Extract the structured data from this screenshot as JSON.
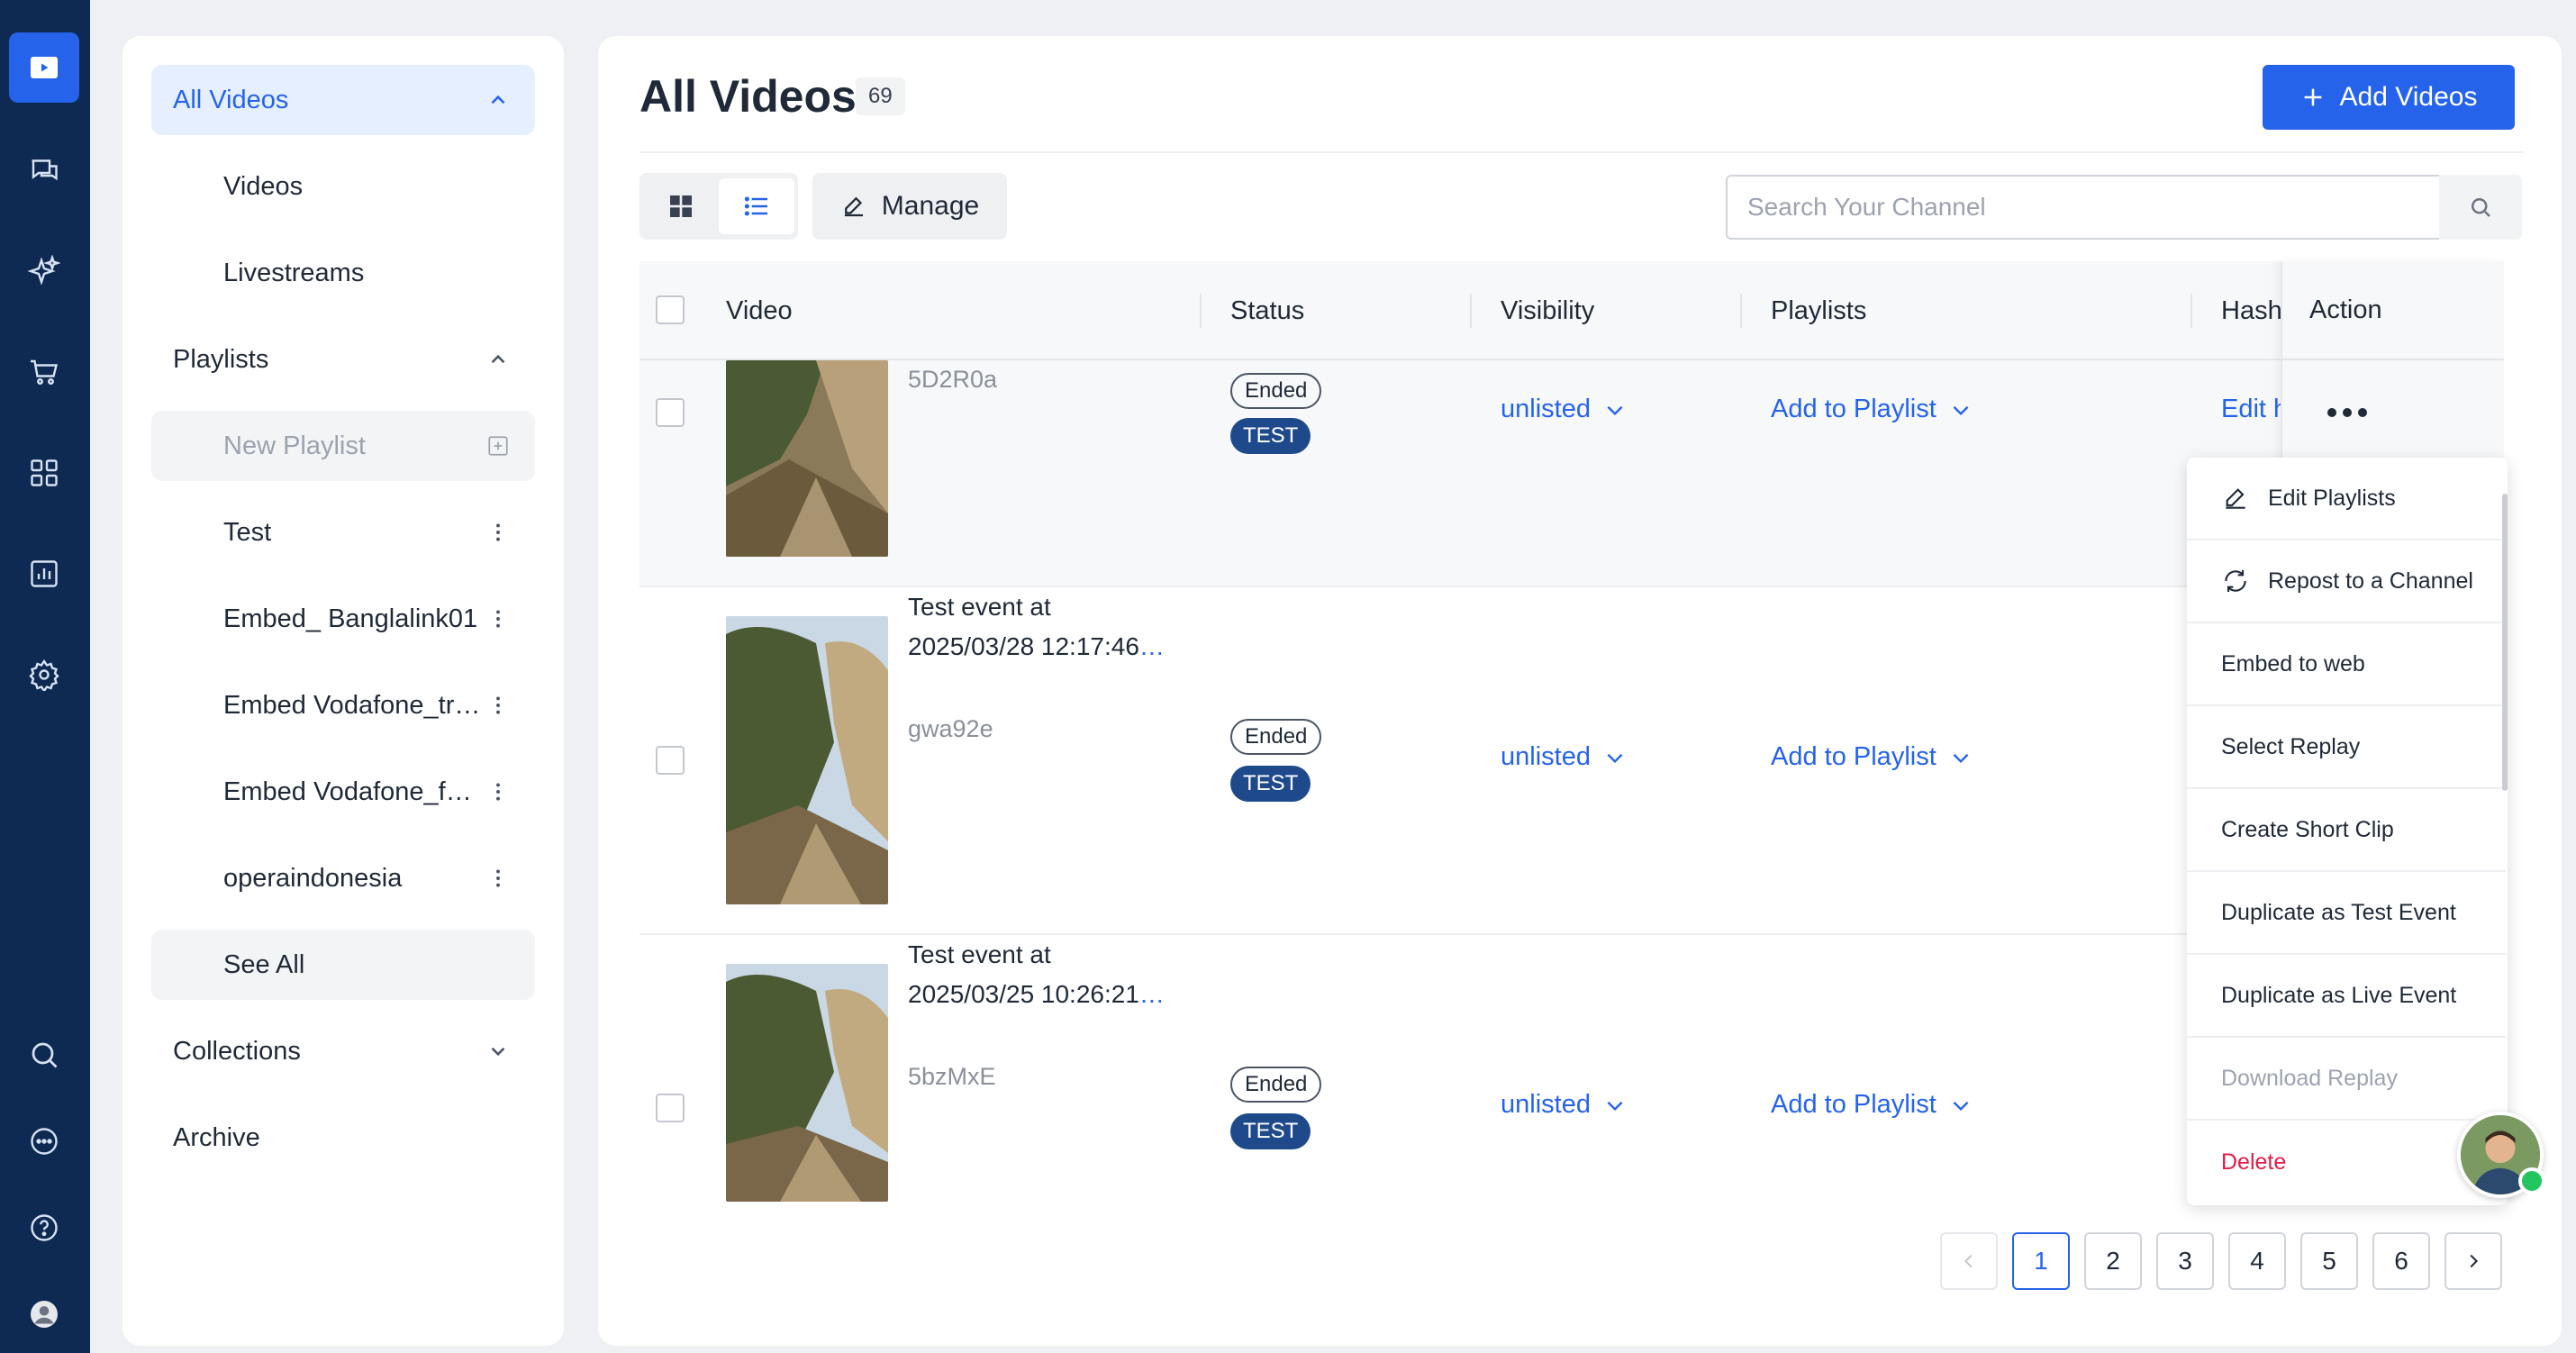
{
  "sidebar": {
    "all_videos": "All Videos",
    "videos": "Videos",
    "livestreams": "Livestreams",
    "playlists": "Playlists",
    "new_playlist": "New Playlist",
    "playlist_items": [
      "Test",
      "Embed_ Banglalink01",
      "Embed Vodafone_tr…",
      "Embed Vodafone_f…",
      "operaindonesia"
    ],
    "see_all": "See All",
    "collections": "Collections",
    "archive": "Archive"
  },
  "header": {
    "title": "All Videos",
    "count": "69",
    "add_videos_label": "Add Videos"
  },
  "toolbar": {
    "manage_label": "Manage",
    "search_placeholder": "Search Your Channel"
  },
  "table": {
    "columns": [
      "Video",
      "Status",
      "Visibility",
      "Playlists",
      "Hashtags",
      "Action"
    ],
    "rows": [
      {
        "title": "",
        "code": "5D2R0a",
        "status": "Ended",
        "tag": "TEST",
        "visibility": "unlisted",
        "playlist": "Add to Playlist",
        "hashtag": "Edit hashtags"
      },
      {
        "title_line1": "Test event at",
        "title_line2": "2025/03/28 12:17:46",
        "more": "…",
        "code": "gwa92e",
        "status": "Ended",
        "tag": "TEST",
        "visibility": "unlisted",
        "playlist": "Add to Playlist"
      },
      {
        "title_line1": "Test event at",
        "title_line2": "2025/03/25 10:26:21",
        "more": "…",
        "code": "5bzMxE",
        "status": "Ended",
        "tag": "TEST",
        "visibility": "unlisted",
        "playlist": "Add to Playlist"
      }
    ]
  },
  "menu": {
    "items": [
      "Edit Playlists",
      "Repost to a Channel",
      "Embed to web",
      "Select Replay",
      "Create Short Clip",
      "Duplicate as Test Event",
      "Duplicate as Live Event",
      "Download Replay",
      "Delete"
    ]
  },
  "pagination": {
    "pages": [
      "1",
      "2",
      "3",
      "4",
      "5",
      "6"
    ],
    "current": "1"
  },
  "colors": {
    "rail_bg": "#0f2a52",
    "accent": "#2563eb",
    "danger": "#e11d48",
    "test_tag": "#1e4a8c",
    "online": "#22c55e"
  },
  "icons": {
    "rail": [
      "video-icon",
      "chat-icon",
      "sparkle-icon",
      "cart-icon",
      "grid-icon",
      "chart-icon",
      "gear-icon",
      "search-icon",
      "message-icon",
      "help-icon",
      "user-icon"
    ]
  }
}
